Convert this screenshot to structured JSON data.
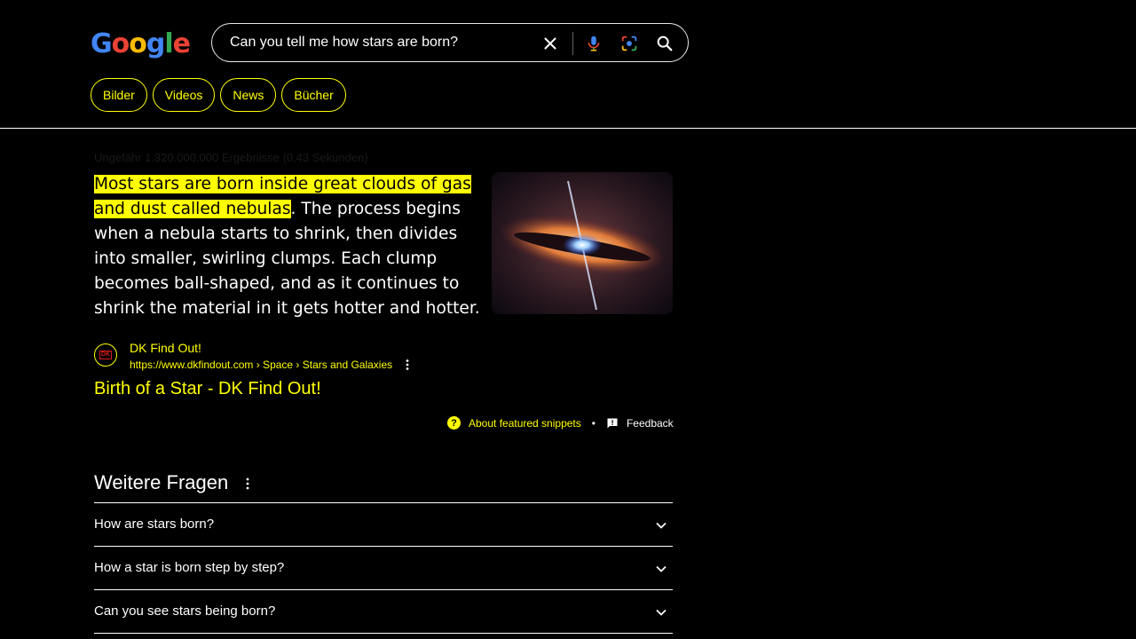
{
  "header": {
    "logo": "Google",
    "logo_colors": [
      "#4285F4",
      "#EA4335",
      "#FBBC05",
      "#4285F4",
      "#34A853",
      "#EA4335"
    ],
    "search_value": "Can you tell me how stars are born?",
    "icons": [
      "close-icon",
      "microphone-icon",
      "lens-icon",
      "search-icon"
    ]
  },
  "chips": [
    "Bilder",
    "Videos",
    "News",
    "Bücher"
  ],
  "results": {
    "stats": "Ungefähr 1.320.000.000 Ergebnisse (0,43 Sekunden)",
    "snippet_highlight_1": "Most stars are born inside great clouds of gas",
    "snippet_highlight_2": "and dust called nebulas",
    "snippet_rest": ". The process begins when a nebula starts to shrink, then divides into smaller, swirling clumps. Each clump becomes ball-shaped, and as it continues to shrink the material in it gets hotter and hotter.",
    "source_name": "DK Find Out!",
    "source_favicon": "DK",
    "source_url": "https://www.dkfindout.com › Space › Stars and Galaxies",
    "title": "Birth of a Star - DK Find Out!",
    "about_label": "About featured snippets",
    "separator": "•",
    "feedback_label": "Feedback"
  },
  "paa": {
    "heading": "Weitere Fragen",
    "questions": [
      "How are stars born?",
      "How a star is born step by step?",
      "Can you see stars being born?"
    ]
  },
  "colors": {
    "accent": "#ffff00",
    "background": "#000000"
  }
}
